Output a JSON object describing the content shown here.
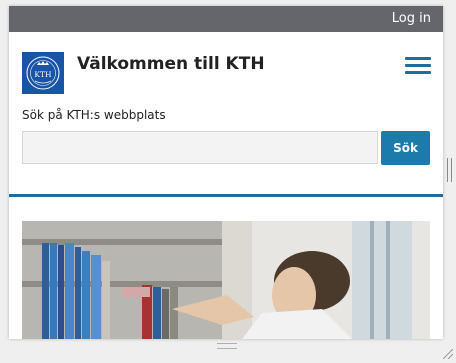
{
  "topbar": {
    "login_label": "Log in"
  },
  "header": {
    "title": "Välkommen till KTH",
    "logo_text": "KTH",
    "menu_icon": "hamburger-menu-icon"
  },
  "search": {
    "label": "Sök på KTH:s webbplats",
    "input_value": "",
    "button_label": "Sök"
  },
  "colors": {
    "topbar": "#65656c",
    "accent": "#1b6e9e",
    "button": "#1b7bab",
    "logo": "#1954a6"
  },
  "hero": {
    "image_icon": "hero-photo-student-bookshelf"
  }
}
